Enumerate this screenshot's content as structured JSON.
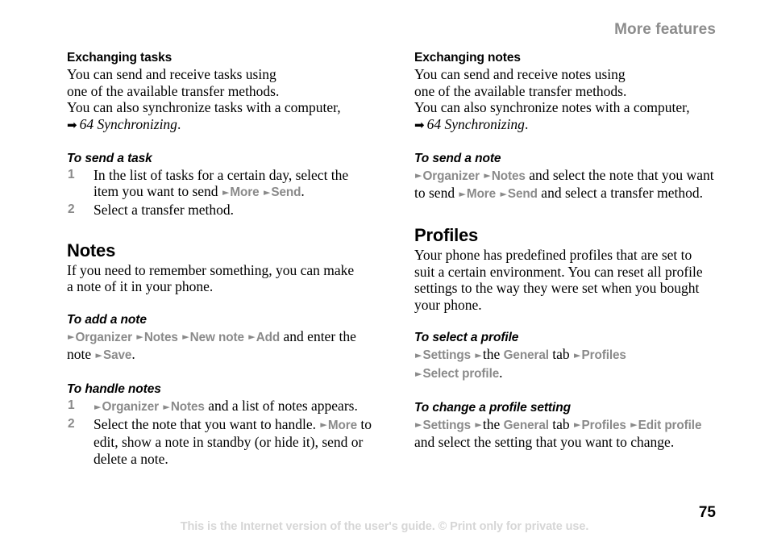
{
  "header": {
    "running_title": "More features"
  },
  "left_column": {
    "exchanging_tasks": {
      "heading": "Exchanging tasks",
      "line1": "You can send and receive tasks using",
      "line2": "one of the available transfer methods.",
      "line3": "You can also synchronize tasks with a computer,",
      "xref_arrow": "arrow-right-icon",
      "xref": "64 Synchronizing",
      "xref_period": "."
    },
    "to_send_a_task": {
      "heading": "To send a task",
      "steps": [
        {
          "number": "1",
          "text_a": "In the list of tasks for a certain day, select the item you want to send ",
          "ui_1": "More",
          "ui_2": "Send",
          "text_b": "."
        },
        {
          "number": "2",
          "text_a": "Select a transfer method."
        }
      ]
    },
    "notes": {
      "heading": "Notes",
      "line1": "If you need to remember something, you can make",
      "line2": "a note of it in your phone."
    },
    "to_add_a_note": {
      "heading": "To add a note",
      "ui_1": "Organizer",
      "ui_2": "Notes",
      "ui_3": "New note",
      "ui_4": "Add",
      "mid_text": " and enter the note ",
      "ui_5": "Save",
      "end_text": "."
    },
    "to_handle_notes": {
      "heading": "To handle notes",
      "step1": {
        "number": "1",
        "ui_1": "Organizer",
        "ui_2": "Notes",
        "text": " and a list of notes appears."
      },
      "step2": {
        "number": "2",
        "text_a": "Select the note that you want to handle. ",
        "ui_1": "More",
        "text_b": " to edit, show a note in standby (or hide it), send or delete a note."
      }
    }
  },
  "right_column": {
    "exchanging_notes": {
      "heading": "Exchanging notes",
      "line1": "You can send and receive notes using",
      "line2": "one of the available transfer methods.",
      "line3": "You can also synchronize notes with a computer,",
      "xref_arrow": "arrow-right-icon",
      "xref": "64 Synchronizing",
      "xref_period": "."
    },
    "to_send_a_note": {
      "heading": "To send a note",
      "ui_1": "Organizer",
      "ui_2": "Notes",
      "text_a": " and select the note that you want to send ",
      "ui_3": "More",
      "ui_4": "Send",
      "text_b": " and select a transfer method."
    },
    "profiles": {
      "heading": "Profiles",
      "line1": "Your phone has predefined profiles that are set to",
      "line2": "suit a certain environment. You can reset all profile",
      "line3": "settings to the way they were set when you bought",
      "line4": "your phone."
    },
    "to_select_a_profile": {
      "heading": "To select a profile",
      "ui_1": "Settings",
      "text_the": "the",
      "ui_2": "General",
      "text_tab": "tab",
      "ui_3": "Profiles",
      "ui_4": "Select profile",
      "end_text": "."
    },
    "to_change_a_profile_setting": {
      "heading": "To change a profile setting",
      "ui_1": "Settings",
      "text_the": "the",
      "ui_2": "General",
      "text_tab": "tab",
      "ui_3": "Profiles",
      "ui_4": "Edit profile",
      "end_text": " and select the setting that you want to change."
    }
  },
  "footer": {
    "page_number": "75",
    "disclaimer": "This is the Internet version of the user's guide. © Print only for private use."
  },
  "glyphs": {
    "triangle": "►",
    "fat_arrow": "➡"
  },
  "colors": {
    "ui_term_gray": "#8a8a8a",
    "header_gray": "#8c8c8c",
    "footer_gray": "#d6d6d6",
    "text_black": "#000000",
    "page_background": "#ffffff"
  }
}
